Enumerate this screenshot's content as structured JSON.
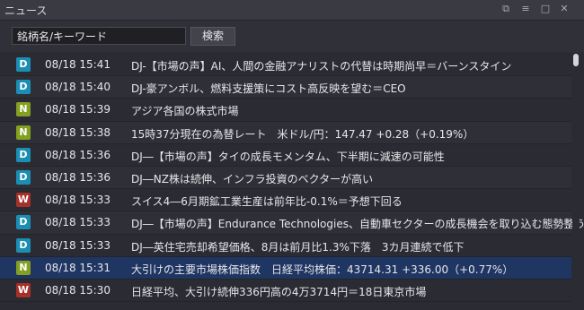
{
  "window": {
    "title": "ニュース"
  },
  "search": {
    "placeholder": "銘柄名/キーワード",
    "value": "銘柄名/キーワード",
    "button": "検索"
  },
  "colors": {
    "D": "#1b8fb3",
    "N": "#84a020",
    "W": "#a7302a",
    "selected": "#1f3562"
  },
  "news": [
    {
      "source": "D",
      "time": "08/18 15:41",
      "headline": "DJ-【市場の声】AI、人間の金融アナリストの代替は時期尚早＝バーンスタイン"
    },
    {
      "source": "D",
      "time": "08/18 15:40",
      "headline": "DJ-豪アンボル、燃料支援策にコスト高反映を望む＝CEO"
    },
    {
      "source": "N",
      "time": "08/18 15:39",
      "headline": "アジア各国の株式市場"
    },
    {
      "source": "N",
      "time": "08/18 15:38",
      "headline": "15時37分現在の為替レート　米ドル/円：147.47 +0.28（+0.19%）"
    },
    {
      "source": "D",
      "time": "08/18 15:36",
      "headline": "DJ―【市場の声】タイの成長モメンタム、下半期に減速の可能性"
    },
    {
      "source": "D",
      "time": "08/18 15:36",
      "headline": "DJ―NZ株は続伸、インフラ投資のベクターが高い"
    },
    {
      "source": "W",
      "time": "08/18 15:33",
      "headline": "スイス4―6月期鉱工業生産は前年比-0.1%＝予想下回る"
    },
    {
      "source": "D",
      "time": "08/18 15:33",
      "headline": "DJ―【市場の声】Endurance Technologies、自動車セクターの成長機会を取り込む態勢整う"
    },
    {
      "source": "D",
      "time": "08/18 15:33",
      "headline": "DJ―英住宅売却希望価格、8月は前月比1.3%下落　3カ月連続で低下"
    },
    {
      "source": "N",
      "time": "08/18 15:31",
      "headline": "大引けの主要市場株価指数　日経平均株価：43714.31 +336.00（+0.77%）",
      "selected": true
    },
    {
      "source": "W",
      "time": "08/18 15:30",
      "headline": "日経平均、大引け続伸336円高の4万3714円＝18日東京市場"
    }
  ]
}
